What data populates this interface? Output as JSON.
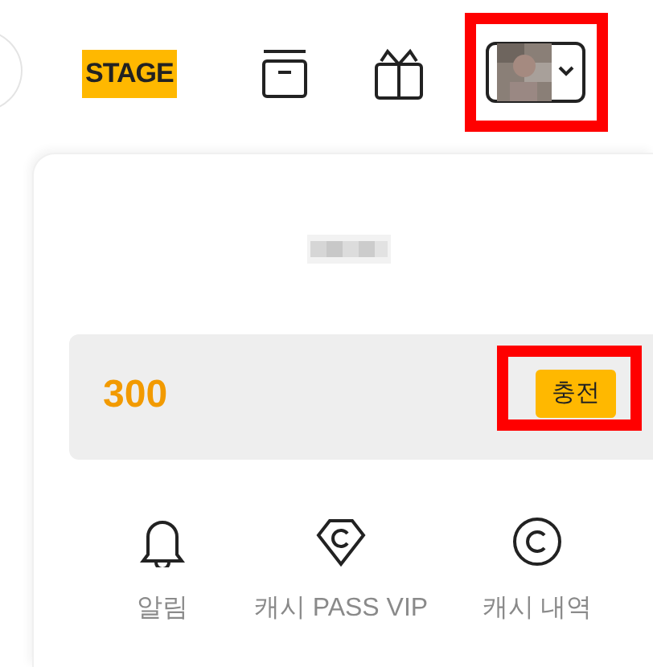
{
  "header": {
    "logo": "STAGE",
    "profile_button": {
      "highlighted": true
    }
  },
  "cash": {
    "amount": "300",
    "charge_button": {
      "label": "충전",
      "highlighted": true
    }
  },
  "menu": [
    {
      "kind": "bell",
      "label": "알림"
    },
    {
      "kind": "diamond",
      "label": "캐시 PASS VIP"
    },
    {
      "kind": "coin",
      "label": "캐시 내역"
    }
  ]
}
